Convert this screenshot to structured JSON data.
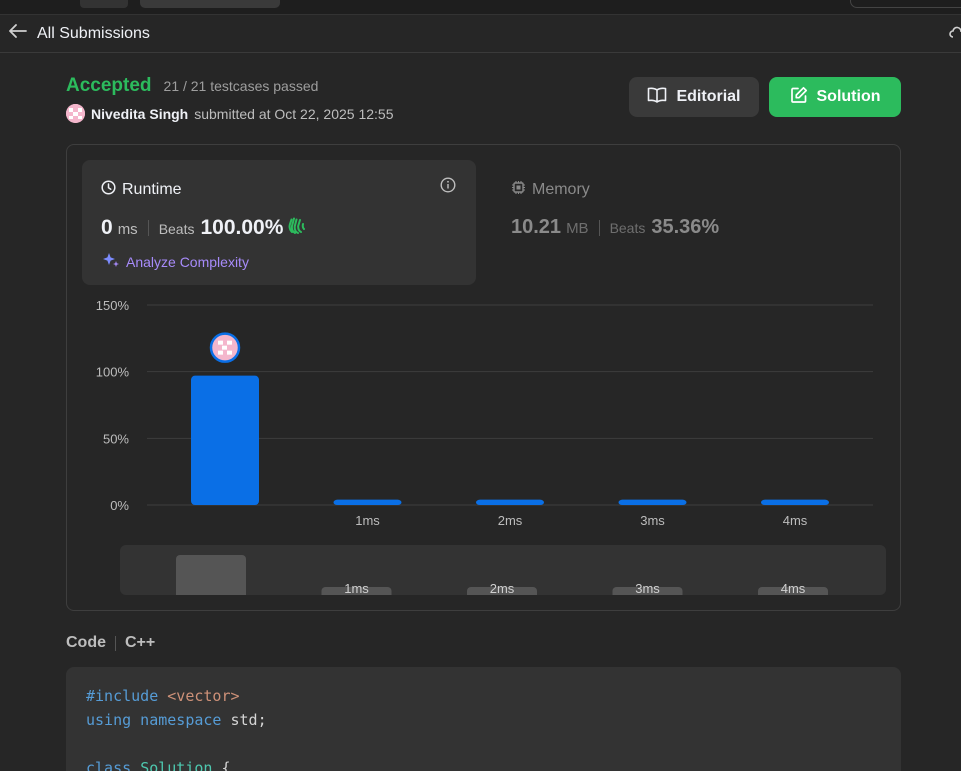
{
  "nav": {
    "back_label": "All Submissions"
  },
  "submission": {
    "status": "Accepted",
    "testcases": "21 / 21 testcases passed",
    "user": "Nivedita Singh",
    "submitted_text": "submitted at Oct 22, 2025 12:55"
  },
  "buttons": {
    "editorial": "Editorial",
    "solution": "Solution"
  },
  "runtime": {
    "label": "Runtime",
    "value": "0",
    "unit": "ms",
    "beats_label": "Beats",
    "beats_value": "100.00%",
    "analyze_label": "Analyze Complexity"
  },
  "memory": {
    "label": "Memory",
    "value": "10.21",
    "unit": "MB",
    "beats_label": "Beats",
    "beats_value": "35.36%"
  },
  "chart_data": {
    "type": "bar",
    "categories": [
      "",
      "1ms",
      "2ms",
      "3ms",
      "4ms"
    ],
    "values": [
      97,
      4,
      4,
      4,
      4
    ],
    "y_ticks": [
      "0%",
      "50%",
      "100%",
      "150%"
    ],
    "ylim": [
      0,
      150
    ],
    "grid": true,
    "highlight_index": 0,
    "mini_categories": [
      "",
      "1ms",
      "2ms",
      "3ms",
      "4ms"
    ],
    "colors": {
      "bar": "#0a6fe6",
      "grid": "#3d3d3d",
      "mini_bar": "#555555"
    }
  },
  "code": {
    "label": "Code",
    "language": "C++",
    "lines": [
      [
        {
          "t": "#include ",
          "c": "kw"
        },
        {
          "t": "<vector>",
          "c": "str"
        }
      ],
      [
        {
          "t": "using namespace ",
          "c": "kw"
        },
        {
          "t": "std;",
          "c": ""
        }
      ],
      [
        {
          "t": "",
          "c": ""
        }
      ],
      [
        {
          "t": "class ",
          "c": "kw"
        },
        {
          "t": "Solution",
          "c": "cls"
        },
        {
          "t": " {",
          "c": ""
        }
      ]
    ]
  },
  "colors": {
    "accent_green": "#2cbb5d",
    "bar_blue": "#0a6fe6",
    "analyze_purple": "#a78bfa"
  }
}
